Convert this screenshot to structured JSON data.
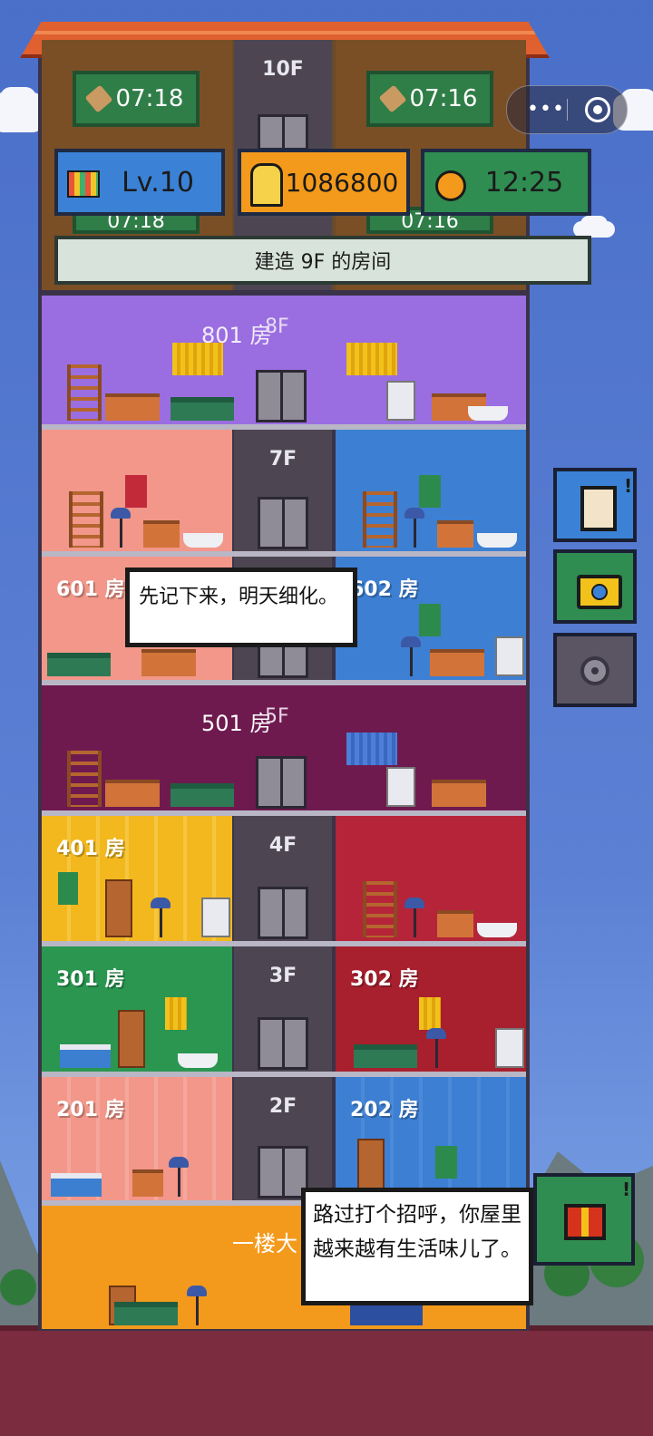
{
  "hud": {
    "level": "Lv.10",
    "coins": "1086800",
    "time": "12:25",
    "build_prompt": "建造 9F 的房间"
  },
  "top_floor": {
    "floor_label": "10F",
    "timer_left": "07:18",
    "timer_right": "07:16",
    "timer_left_ghost": "07:18",
    "timer_right_ghost": "07:16"
  },
  "floors": {
    "f8": {
      "room": "801 房",
      "floor": "8F"
    },
    "f7": {
      "floor": "7F"
    },
    "f6": {
      "room_left": "601 房",
      "room_right": "602 房"
    },
    "f5": {
      "room": "501 房",
      "floor": "5F"
    },
    "f4": {
      "room_left": "401 房",
      "floor": "4F"
    },
    "f3": {
      "room_left": "301 房",
      "floor": "3F",
      "room_right": "302 房"
    },
    "f2": {
      "room_left": "201 房",
      "floor": "2F",
      "room_right": "202 房"
    },
    "f1": {
      "lobby": "一楼大"
    }
  },
  "bubbles": {
    "note": "先记下来，明天细化。",
    "greeting": "路过打个招呼，你屋里越来越有生活味儿了。"
  },
  "icons": {
    "menu": "more-dots-icon",
    "close": "target-circle-icon",
    "tasks": "clipboard-icon",
    "camera": "camera-icon",
    "settings": "gear-icon",
    "gift": "gift-icon"
  },
  "colors": {
    "sky": "#5b80d4",
    "roof": "#e0602f",
    "ground": "#7b2c3f",
    "hud_blue": "#3b82d6",
    "hud_orange": "#f39a1c",
    "hud_green": "#2f8d52"
  }
}
